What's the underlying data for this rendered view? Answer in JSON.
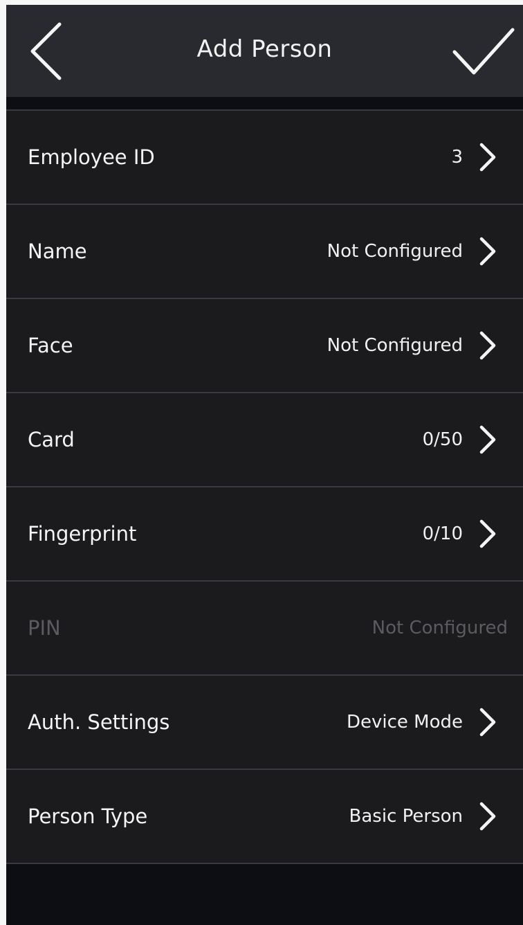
{
  "header": {
    "title": "Add Person",
    "back_icon": "chevron-left-icon",
    "confirm_icon": "checkmark-icon"
  },
  "rows": [
    {
      "label": "Employee ID",
      "value": "3",
      "enabled": true,
      "icon": "chevron-right-icon"
    },
    {
      "label": "Name",
      "value": "Not Configured",
      "enabled": true,
      "icon": "chevron-right-icon"
    },
    {
      "label": "Face",
      "value": "Not Configured",
      "enabled": true,
      "icon": "chevron-right-icon"
    },
    {
      "label": "Card",
      "value": "0/50",
      "enabled": true,
      "icon": "chevron-right-icon"
    },
    {
      "label": "Fingerprint",
      "value": "0/10",
      "enabled": true,
      "icon": "chevron-right-icon"
    },
    {
      "label": "PIN",
      "value": "Not Configured",
      "enabled": false
    },
    {
      "label": "Auth. Settings",
      "value": "Device Mode",
      "enabled": true,
      "icon": "chevron-right-icon"
    },
    {
      "label": "Person Type",
      "value": "Basic Person",
      "enabled": true,
      "icon": "chevron-right-icon"
    }
  ],
  "colors": {
    "header_bg": "#292930",
    "row_bg": "#1b1b1e",
    "screen_bg": "#0d0d14",
    "divider": "#3a3a40",
    "text": "#f4f4f4",
    "disabled_text": "#5b5b60"
  }
}
